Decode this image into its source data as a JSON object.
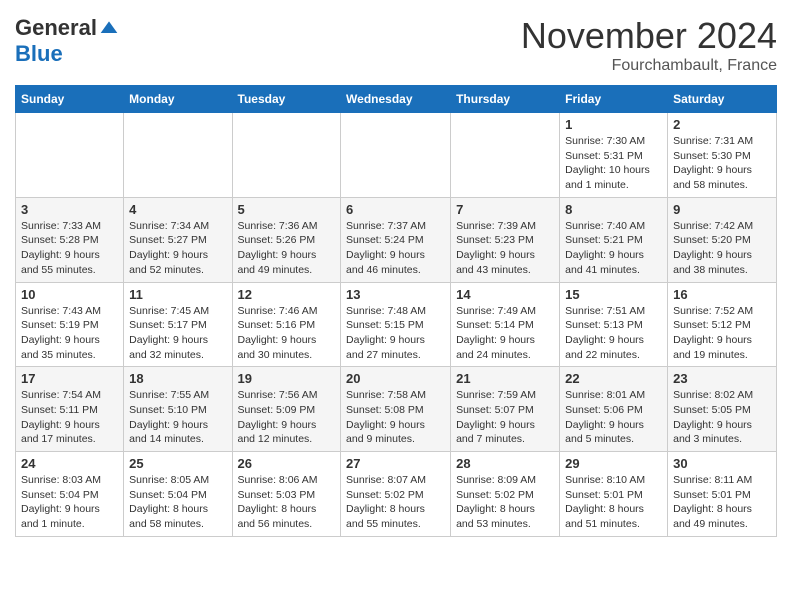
{
  "logo": {
    "general": "General",
    "blue": "Blue"
  },
  "header": {
    "month": "November 2024",
    "location": "Fourchambault, France"
  },
  "weekdays": [
    "Sunday",
    "Monday",
    "Tuesday",
    "Wednesday",
    "Thursday",
    "Friday",
    "Saturday"
  ],
  "weeks": [
    [
      {
        "day": "",
        "info": ""
      },
      {
        "day": "",
        "info": ""
      },
      {
        "day": "",
        "info": ""
      },
      {
        "day": "",
        "info": ""
      },
      {
        "day": "",
        "info": ""
      },
      {
        "day": "1",
        "info": "Sunrise: 7:30 AM\nSunset: 5:31 PM\nDaylight: 10 hours and 1 minute."
      },
      {
        "day": "2",
        "info": "Sunrise: 7:31 AM\nSunset: 5:30 PM\nDaylight: 9 hours and 58 minutes."
      }
    ],
    [
      {
        "day": "3",
        "info": "Sunrise: 7:33 AM\nSunset: 5:28 PM\nDaylight: 9 hours and 55 minutes."
      },
      {
        "day": "4",
        "info": "Sunrise: 7:34 AM\nSunset: 5:27 PM\nDaylight: 9 hours and 52 minutes."
      },
      {
        "day": "5",
        "info": "Sunrise: 7:36 AM\nSunset: 5:26 PM\nDaylight: 9 hours and 49 minutes."
      },
      {
        "day": "6",
        "info": "Sunrise: 7:37 AM\nSunset: 5:24 PM\nDaylight: 9 hours and 46 minutes."
      },
      {
        "day": "7",
        "info": "Sunrise: 7:39 AM\nSunset: 5:23 PM\nDaylight: 9 hours and 43 minutes."
      },
      {
        "day": "8",
        "info": "Sunrise: 7:40 AM\nSunset: 5:21 PM\nDaylight: 9 hours and 41 minutes."
      },
      {
        "day": "9",
        "info": "Sunrise: 7:42 AM\nSunset: 5:20 PM\nDaylight: 9 hours and 38 minutes."
      }
    ],
    [
      {
        "day": "10",
        "info": "Sunrise: 7:43 AM\nSunset: 5:19 PM\nDaylight: 9 hours and 35 minutes."
      },
      {
        "day": "11",
        "info": "Sunrise: 7:45 AM\nSunset: 5:17 PM\nDaylight: 9 hours and 32 minutes."
      },
      {
        "day": "12",
        "info": "Sunrise: 7:46 AM\nSunset: 5:16 PM\nDaylight: 9 hours and 30 minutes."
      },
      {
        "day": "13",
        "info": "Sunrise: 7:48 AM\nSunset: 5:15 PM\nDaylight: 9 hours and 27 minutes."
      },
      {
        "day": "14",
        "info": "Sunrise: 7:49 AM\nSunset: 5:14 PM\nDaylight: 9 hours and 24 minutes."
      },
      {
        "day": "15",
        "info": "Sunrise: 7:51 AM\nSunset: 5:13 PM\nDaylight: 9 hours and 22 minutes."
      },
      {
        "day": "16",
        "info": "Sunrise: 7:52 AM\nSunset: 5:12 PM\nDaylight: 9 hours and 19 minutes."
      }
    ],
    [
      {
        "day": "17",
        "info": "Sunrise: 7:54 AM\nSunset: 5:11 PM\nDaylight: 9 hours and 17 minutes."
      },
      {
        "day": "18",
        "info": "Sunrise: 7:55 AM\nSunset: 5:10 PM\nDaylight: 9 hours and 14 minutes."
      },
      {
        "day": "19",
        "info": "Sunrise: 7:56 AM\nSunset: 5:09 PM\nDaylight: 9 hours and 12 minutes."
      },
      {
        "day": "20",
        "info": "Sunrise: 7:58 AM\nSunset: 5:08 PM\nDaylight: 9 hours and 9 minutes."
      },
      {
        "day": "21",
        "info": "Sunrise: 7:59 AM\nSunset: 5:07 PM\nDaylight: 9 hours and 7 minutes."
      },
      {
        "day": "22",
        "info": "Sunrise: 8:01 AM\nSunset: 5:06 PM\nDaylight: 9 hours and 5 minutes."
      },
      {
        "day": "23",
        "info": "Sunrise: 8:02 AM\nSunset: 5:05 PM\nDaylight: 9 hours and 3 minutes."
      }
    ],
    [
      {
        "day": "24",
        "info": "Sunrise: 8:03 AM\nSunset: 5:04 PM\nDaylight: 9 hours and 1 minute."
      },
      {
        "day": "25",
        "info": "Sunrise: 8:05 AM\nSunset: 5:04 PM\nDaylight: 8 hours and 58 minutes."
      },
      {
        "day": "26",
        "info": "Sunrise: 8:06 AM\nSunset: 5:03 PM\nDaylight: 8 hours and 56 minutes."
      },
      {
        "day": "27",
        "info": "Sunrise: 8:07 AM\nSunset: 5:02 PM\nDaylight: 8 hours and 55 minutes."
      },
      {
        "day": "28",
        "info": "Sunrise: 8:09 AM\nSunset: 5:02 PM\nDaylight: 8 hours and 53 minutes."
      },
      {
        "day": "29",
        "info": "Sunrise: 8:10 AM\nSunset: 5:01 PM\nDaylight: 8 hours and 51 minutes."
      },
      {
        "day": "30",
        "info": "Sunrise: 8:11 AM\nSunset: 5:01 PM\nDaylight: 8 hours and 49 minutes."
      }
    ]
  ]
}
